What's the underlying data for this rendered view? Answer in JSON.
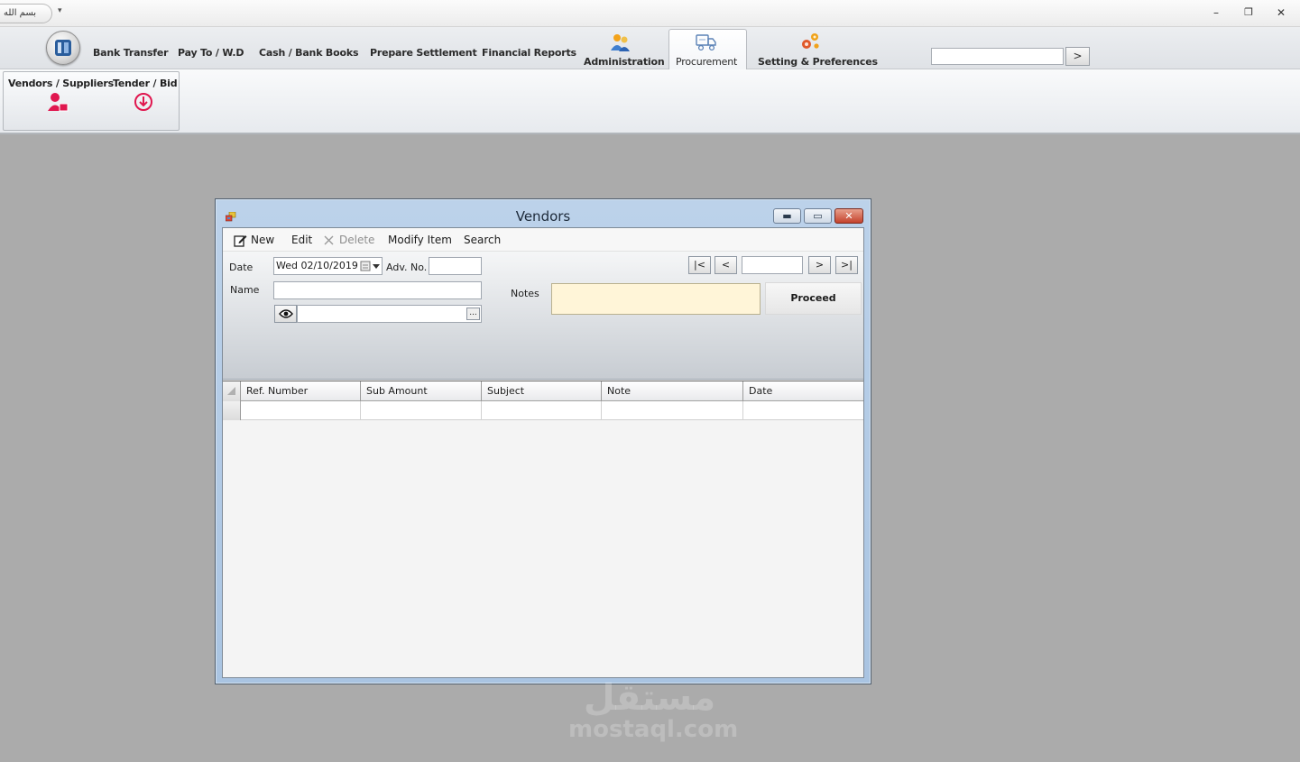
{
  "titlebar": {
    "qat_label": "بسم الله",
    "dropdown_glyph": "▾",
    "window_controls": {
      "minimize": "–",
      "restore": "❐",
      "close": "✕"
    }
  },
  "ribbon": {
    "tabs": [
      {
        "label": "Bank Transfer"
      },
      {
        "label": "Pay To / W.D"
      },
      {
        "label": "Cash  / Bank Books"
      },
      {
        "label": "Prepare Settlement"
      },
      {
        "label": "Financial Reports"
      },
      {
        "label": "Administration",
        "icon": "users-icon"
      },
      {
        "label": "Procurement",
        "icon": "truck-icon",
        "active": true
      },
      {
        "label": "Setting & Preferences",
        "icon": "gears-icon"
      }
    ],
    "search": {
      "value": "",
      "go_label": ">"
    },
    "group": {
      "buttons": [
        {
          "label": "Vendors / Suppliers",
          "icon": "vendor-user-icon"
        },
        {
          "label": "Tender / Bid",
          "icon": "download-circle-icon"
        }
      ]
    }
  },
  "vendors_window": {
    "title": "Vendors",
    "controls": {
      "minimize": "▬",
      "maximize": "▭",
      "close": "✕"
    },
    "toolbar": {
      "new": "New",
      "edit": "Edit",
      "delete": "Delete",
      "modify_item": "Modify Item",
      "search": "Search"
    },
    "form": {
      "date_label": "Date",
      "date_value": "Wed 02/10/2019",
      "adv_no_label": "Adv. No.",
      "adv_no_value": "",
      "name_label": "Name",
      "name_value": "",
      "notes_label": "Notes",
      "notes_value": "",
      "browse_value": "",
      "browse_button": "...",
      "proceed_label": "Proceed",
      "record_position": "",
      "nav": {
        "first": "|<",
        "prev": "<",
        "next": ">",
        "last": ">|"
      }
    },
    "grid": {
      "columns": [
        "Ref. Number",
        "Sub Amount",
        "Subject",
        "Note",
        "Date"
      ],
      "rows": []
    }
  },
  "watermark": {
    "arabic": "مستقل",
    "latin": "mostaql.com"
  },
  "colors": {
    "workspace": "#ababab",
    "window_frame": "#a9c4e2",
    "notes_bg": "#fff5d8",
    "close_red": "#c4422c",
    "accent_pink": "#e0174f"
  }
}
